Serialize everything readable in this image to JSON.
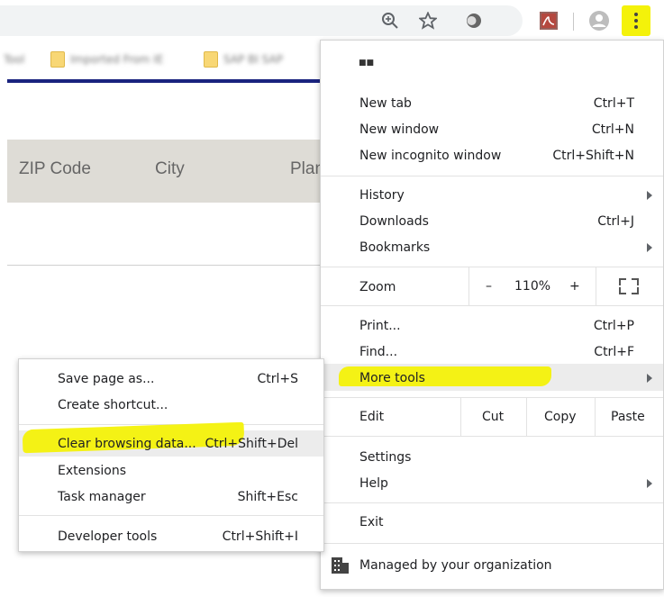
{
  "toolbar": {
    "icons": [
      "zoom-icon",
      "star-icon",
      "extension-icon",
      "pdf-icon",
      "avatar-icon",
      "kebab-menu-icon"
    ]
  },
  "page": {
    "columns": [
      "ZIP Code",
      "City",
      "Plan"
    ]
  },
  "menu": {
    "items": {
      "new_tab": {
        "label": "New tab",
        "shortcut": "Ctrl+T"
      },
      "new_window": {
        "label": "New window",
        "shortcut": "Ctrl+N"
      },
      "new_incognito": {
        "label": "New incognito window",
        "shortcut": "Ctrl+Shift+N"
      },
      "history": {
        "label": "History"
      },
      "downloads": {
        "label": "Downloads",
        "shortcut": "Ctrl+J"
      },
      "bookmarks": {
        "label": "Bookmarks"
      },
      "print": {
        "label": "Print...",
        "shortcut": "Ctrl+P"
      },
      "find": {
        "label": "Find...",
        "shortcut": "Ctrl+F"
      },
      "more_tools": {
        "label": "More tools"
      },
      "settings": {
        "label": "Settings"
      },
      "help": {
        "label": "Help"
      },
      "exit": {
        "label": "Exit"
      },
      "managed": {
        "label": "Managed by your organization"
      }
    },
    "zoom": {
      "label": "Zoom",
      "minus": "–",
      "value": "110%",
      "plus": "+"
    },
    "edit": {
      "label": "Edit",
      "cut": "Cut",
      "copy": "Copy",
      "paste": "Paste"
    }
  },
  "submenu": {
    "items": {
      "save_page": {
        "label": "Save page as...",
        "shortcut": "Ctrl+S"
      },
      "create_shortcut": {
        "label": "Create shortcut..."
      },
      "clear_browsing": {
        "label": "Clear browsing data...",
        "shortcut": "Ctrl+Shift+Del"
      },
      "extensions": {
        "label": "Extensions"
      },
      "task_manager": {
        "label": "Task manager",
        "shortcut": "Shift+Esc"
      },
      "developer_tools": {
        "label": "Developer tools",
        "shortcut": "Ctrl+Shift+I"
      }
    }
  },
  "colors": {
    "highlight": "#f4f20a",
    "header_bg": "#dedcd6",
    "accent_line": "#1a237e"
  }
}
